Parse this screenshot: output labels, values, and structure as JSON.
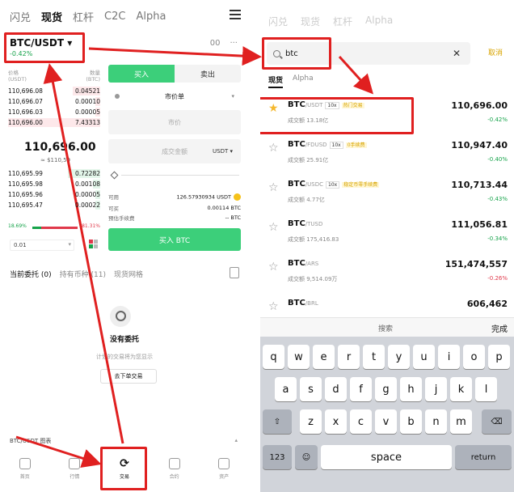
{
  "left": {
    "nav": [
      "闪兑",
      "现货",
      "杠杆",
      "C2C",
      "Alpha"
    ],
    "nav_active": 1,
    "pair": "BTC/USDT ▾",
    "pair_change": "-0.42%",
    "pair_icons": [
      "00",
      "···"
    ],
    "ob_head_left": "价格\n(USDT)",
    "ob_head_right": "数量\n(BTC)",
    "asks": [
      {
        "price": "110,696.08",
        "qty": "0.04521",
        "fill": 0.3
      },
      {
        "price": "110,696.07",
        "qty": "0.00010",
        "fill": 0.05
      },
      {
        "price": "110,696.03",
        "qty": "0.00005",
        "fill": 0.05
      },
      {
        "price": "110,696.00",
        "qty": "7.43313",
        "fill": 1.0
      }
    ],
    "mid_price": "110,696.00",
    "mid_sub": "≈ $110,59",
    "bids": [
      {
        "price": "110,695.99",
        "qty": "0.72282",
        "fill": 0.35
      },
      {
        "price": "110,695.98",
        "qty": "0.00108",
        "fill": 0.08
      },
      {
        "price": "110,695.96",
        "qty": "0.00005",
        "fill": 0.05
      },
      {
        "price": "110,695.47",
        "qty": "0.00022",
        "fill": 0.05
      }
    ],
    "ratio_buy": "18.69%",
    "ratio_sell": "81.31%",
    "ratio_fill": 0.19,
    "depth": "0.01",
    "tab_buy": "买入",
    "tab_sell": "卖出",
    "order_type": "市价单",
    "field_price": "市价",
    "field_amount": "成交金额",
    "field_unit": "USDT ▾",
    "avail_label": "可用",
    "avail_value": "126.57930934 USDT",
    "buyable_label": "可买",
    "buyable_value": "0.00114 BTC",
    "fee_label": "预估手续费",
    "fee_value": "-- BTC",
    "buy_button": "买入 BTC",
    "order_tabs": [
      "当前委托 (0)",
      "持有币种 (11)",
      "现货网格"
    ],
    "empty_title": "没有委托",
    "empty_sub": "计划的交易将为您显示",
    "empty_button": "去下单交易",
    "chart_label": "BTC/USDT 图表",
    "chart_caret": "▴",
    "bottom_nav": [
      "首页",
      "行情",
      "交易",
      "合约",
      "资产"
    ],
    "bottom_active": 2
  },
  "right": {
    "faded_nav": [
      "闪兑",
      "现货",
      "杠杆",
      "Alpha"
    ],
    "search_value": "btc",
    "cancel": "取消",
    "tabs": [
      "现货",
      "Alpha"
    ],
    "results": [
      {
        "base": "BTC",
        "quote": "/USDT",
        "lev": "10x",
        "tag": "热门交易",
        "vol": "成交额 13.18亿",
        "price": "110,696.00",
        "pct": "-0.42%",
        "dir": "pos",
        "fav": true
      },
      {
        "base": "BTC",
        "quote": "/FDUSD",
        "lev": "10x",
        "tag": "0手续费",
        "vol": "成交额 25.91亿",
        "price": "110,947.40",
        "pct": "-0.40%",
        "dir": "pos",
        "fav": false
      },
      {
        "base": "BTC",
        "quote": "/USDC",
        "lev": "10x",
        "tag": "稳定币零手续费",
        "vol": "成交额 4.77亿",
        "price": "110,713.44",
        "pct": "-0.43%",
        "dir": "pos",
        "fav": false
      },
      {
        "base": "BTC",
        "quote": "/TUSD",
        "lev": "",
        "tag": "",
        "vol": "成交额 175,416.83",
        "price": "111,056.81",
        "pct": "-0.34%",
        "dir": "pos",
        "fav": false
      },
      {
        "base": "BTC",
        "quote": "/ARS",
        "lev": "",
        "tag": "",
        "vol": "成交额 9,514.09万",
        "price": "151,474,557",
        "pct": "-0.26%",
        "dir": "neg",
        "fav": false
      },
      {
        "base": "BTC",
        "quote": "/BRL",
        "lev": "",
        "tag": "",
        "vol": "",
        "price": "606,462",
        "pct": "",
        "dir": "pos",
        "fav": false
      }
    ],
    "kb_label": "搜索",
    "kb_done": "完成",
    "keys_row1": [
      "q",
      "w",
      "e",
      "r",
      "t",
      "y",
      "u",
      "i",
      "o",
      "p"
    ],
    "keys_row2": [
      "a",
      "s",
      "d",
      "f",
      "g",
      "h",
      "j",
      "k",
      "l"
    ],
    "keys_row3": [
      "z",
      "x",
      "c",
      "v",
      "b",
      "n",
      "m"
    ],
    "key_123": "123",
    "key_space": "space",
    "key_return": "return"
  },
  "colors": {
    "highlight": "#e02020",
    "buy": "#3ccf7a",
    "ask": "#e0394b",
    "bid": "#16a34a",
    "accent": "#d8a400"
  }
}
